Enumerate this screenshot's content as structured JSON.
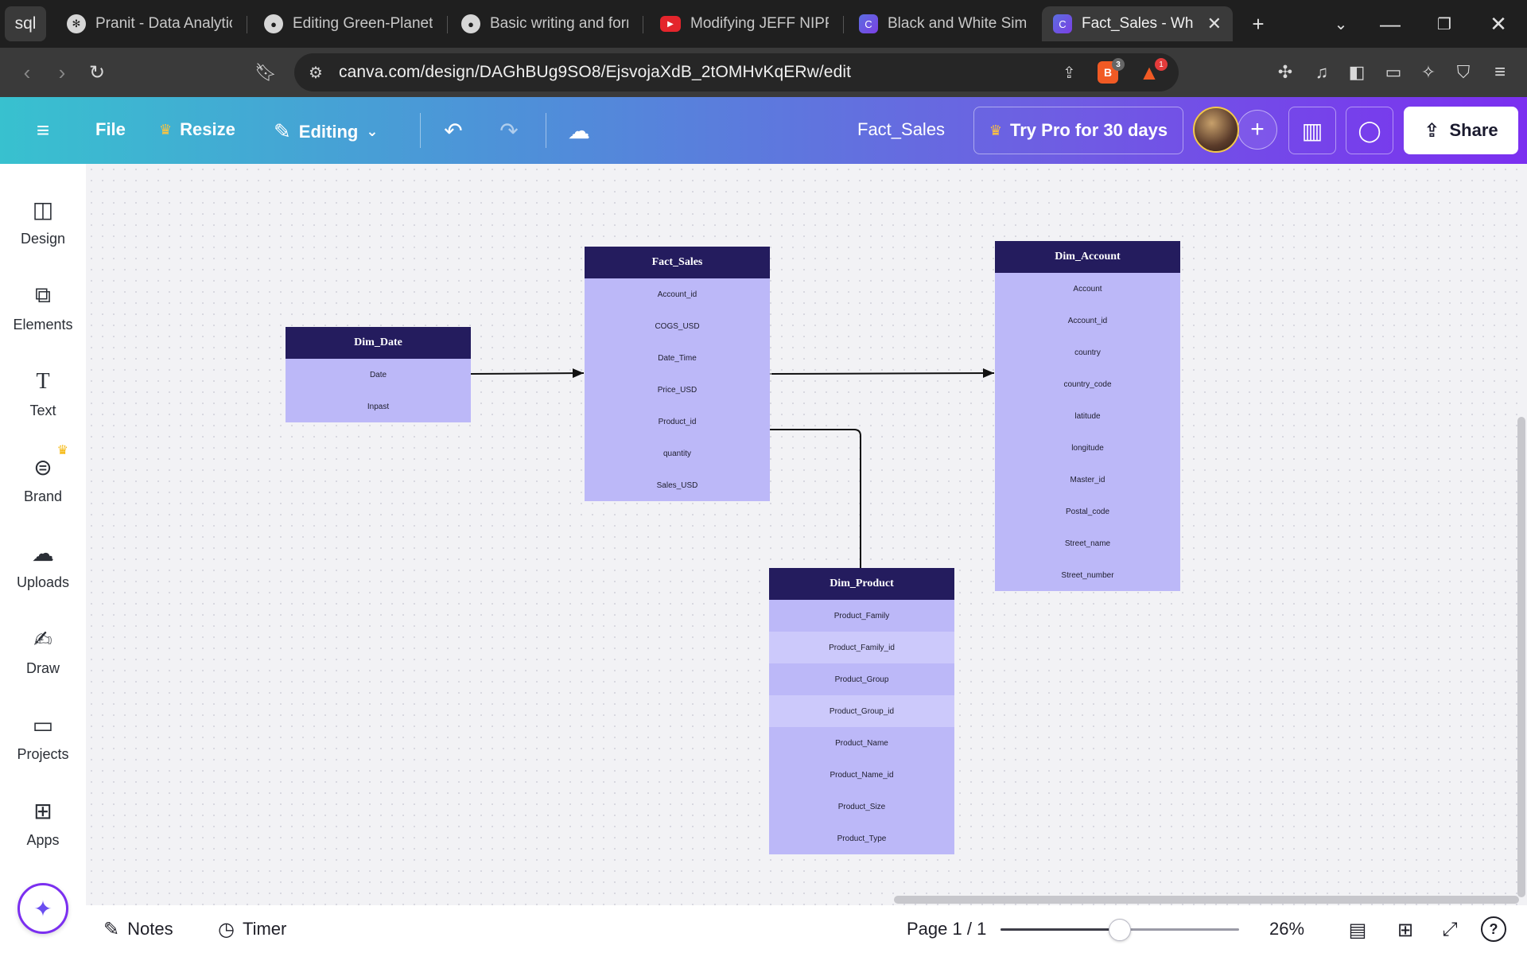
{
  "browser": {
    "first_tab": "sql",
    "tabs": [
      {
        "title": "Pranit - Data Analytics",
        "icon": "openai-icon"
      },
      {
        "title": "Editing Green-Planet-",
        "icon": "github-icon"
      },
      {
        "title": "Basic writing and form",
        "icon": "github-icon"
      },
      {
        "title": "Modifying JEFF NIPPA",
        "icon": "youtube-icon"
      },
      {
        "title": "Black and White Simp",
        "icon": "canva-icon"
      },
      {
        "title": "Fact_Sales - White",
        "icon": "canva-icon",
        "active": true
      }
    ],
    "url": "canva.com/design/DAGhBUg9SO8/EjsvojaXdB_2tOMHvKqERw/edit",
    "shields_count": "3",
    "rewards_count": "1"
  },
  "header": {
    "file": "File",
    "resize": "Resize",
    "editing": "Editing",
    "doc_title": "Fact_Sales",
    "try_pro": "Try Pro for 30 days",
    "share": "Share",
    "gradient_colors": [
      "#38c1cf",
      "#4f8fd9",
      "#6f5ce3",
      "#7b2ff0"
    ]
  },
  "sidebar": {
    "items": [
      {
        "label": "Design",
        "icon": "design-icon"
      },
      {
        "label": "Elements",
        "icon": "elements-icon"
      },
      {
        "label": "Text",
        "icon": "text-icon"
      },
      {
        "label": "Brand",
        "icon": "brand-icon",
        "premium": true
      },
      {
        "label": "Uploads",
        "icon": "upload-cloud-icon"
      },
      {
        "label": "Draw",
        "icon": "draw-pen-icon"
      },
      {
        "label": "Projects",
        "icon": "folder-icon"
      },
      {
        "label": "Apps",
        "icon": "apps-grid-icon"
      }
    ]
  },
  "diagram": {
    "header_color": "#241c5e",
    "row_color": "#bcb8f8",
    "row_highlight_color": "#ccc9fb",
    "tables": {
      "dim_date": {
        "title": "Dim_Date",
        "fields": [
          "Date",
          "Inpast"
        ]
      },
      "fact_sales": {
        "title": "Fact_Sales",
        "fields": [
          "Account_id",
          "COGS_USD",
          "Date_Time",
          "Price_USD",
          "Product_id",
          "quantity",
          "Sales_USD"
        ]
      },
      "dim_account": {
        "title": "Dim_Account",
        "fields": [
          "Account",
          "Account_id",
          "country",
          "country_code",
          "latitude",
          "longitude",
          "Master_id",
          "Postal_code",
          "Street_name",
          "Street_number"
        ]
      },
      "dim_product": {
        "title": "Dim_Product",
        "fields": [
          "Product_Family",
          "Product_Family_id",
          "Product_Group",
          "Product_Group_id",
          "Product_Name",
          "Product_Name_id",
          "Product_Size",
          "Product_Type"
        ]
      }
    }
  },
  "footer": {
    "notes": "Notes",
    "timer": "Timer",
    "page": "Page 1 / 1",
    "zoom": "26%",
    "zoom_fraction": 0.26
  }
}
